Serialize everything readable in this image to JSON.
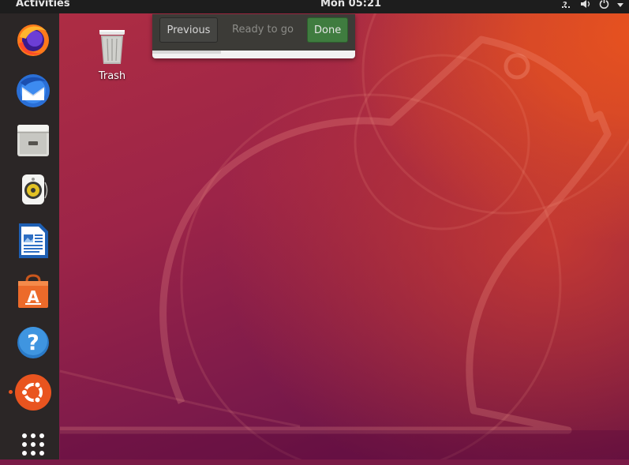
{
  "topbar": {
    "activities_label": "Activities",
    "clock": "Mon 05:21",
    "status_icons": [
      "network-icon",
      "volume-icon",
      "power-icon",
      "menu-caret-icon"
    ]
  },
  "dock": {
    "items": [
      {
        "name": "Firefox",
        "icon": "firefox-icon"
      },
      {
        "name": "Thunderbird",
        "icon": "thunderbird-icon"
      },
      {
        "name": "Files",
        "icon": "files-icon"
      },
      {
        "name": "Rhythmbox",
        "icon": "rhythmbox-icon"
      },
      {
        "name": "LibreOffice Writer",
        "icon": "writer-icon"
      },
      {
        "name": "Ubuntu Software",
        "icon": "software-icon"
      },
      {
        "name": "Help",
        "icon": "help-icon"
      },
      {
        "name": "Ubuntu",
        "icon": "ubuntu-icon",
        "running": true
      },
      {
        "name": "Show Applications",
        "icon": "app-grid-icon"
      }
    ]
  },
  "desktop": {
    "trash_label": "Trash"
  },
  "dialog": {
    "previous_label": "Previous",
    "status_label": "Ready to go",
    "done_label": "Done",
    "progress": 0.34
  },
  "colors": {
    "accent_orange": "#e9541f",
    "done_green": "#3f7c3f",
    "topbar": "#1d1d1d",
    "dock": "#2b2626"
  }
}
